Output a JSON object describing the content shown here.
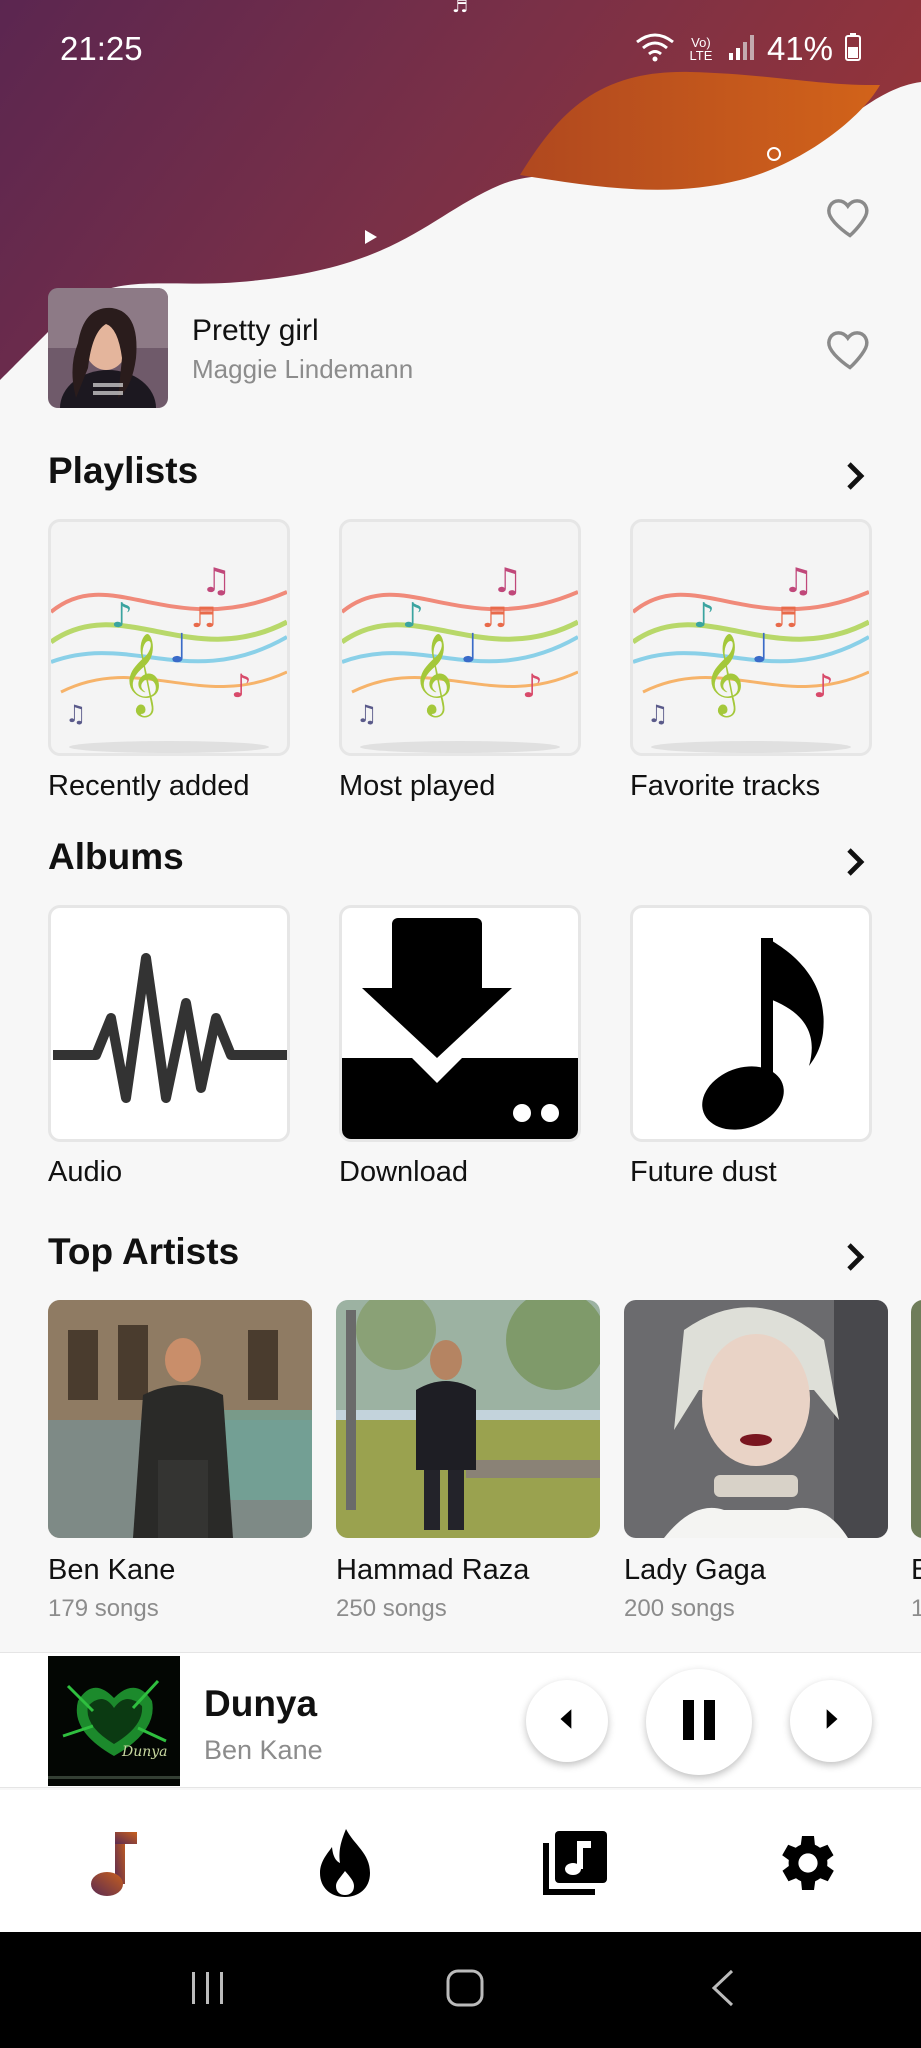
{
  "status_bar": {
    "time": "21:25",
    "network_label": "Vo) LTE",
    "battery": "41%"
  },
  "recent": {
    "title": "Pretty girl",
    "artist": "Maggie Lindemann"
  },
  "playlists": {
    "title": "Playlists",
    "items": [
      {
        "label": "Recently added"
      },
      {
        "label": "Most played"
      },
      {
        "label": "Favorite tracks"
      }
    ]
  },
  "albums": {
    "title": "Albums",
    "items": [
      {
        "label": "Audio",
        "icon": "waveform-icon"
      },
      {
        "label": "Download",
        "icon": "download-icon"
      },
      {
        "label": "Future dust",
        "icon": "music-note-icon"
      }
    ]
  },
  "top_artists": {
    "title": "Top Artists",
    "items": [
      {
        "name": "Ben Kane",
        "songs": "179 songs"
      },
      {
        "name": "Hammad Raza",
        "songs": "250 songs"
      },
      {
        "name": "Lady Gaga",
        "songs": "200 songs"
      },
      {
        "name": "B",
        "songs": "1"
      }
    ]
  },
  "now_playing": {
    "title": "Dunya",
    "artist": "Ben Kane",
    "cover_text": "Dunya"
  },
  "tabs": [
    {
      "icon": "music-note-icon",
      "active": true
    },
    {
      "icon": "fire-icon",
      "active": false
    },
    {
      "icon": "library-icon",
      "active": false
    },
    {
      "icon": "settings-icon",
      "active": false
    }
  ],
  "colors": {
    "accent_purple": "#5a2a52",
    "accent_orange": "#c8601d",
    "text_primary": "#111111",
    "text_secondary": "#8c8c8c"
  }
}
